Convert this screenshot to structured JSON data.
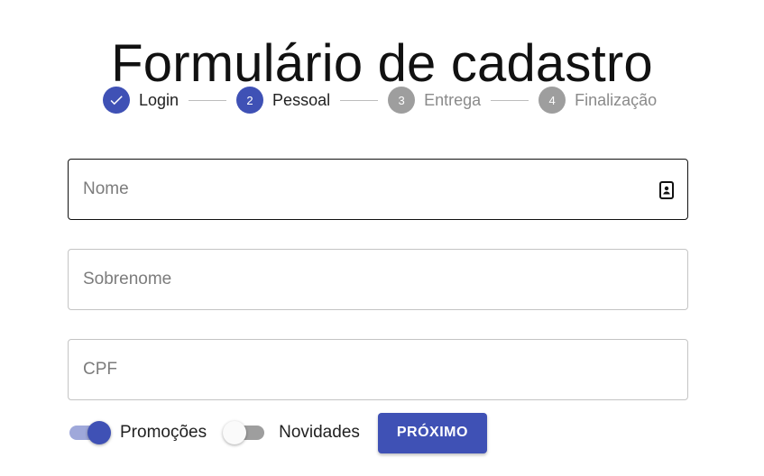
{
  "page_title": "Formulário de cadastro",
  "stepper": {
    "steps": [
      {
        "label": "Login",
        "number": "1",
        "state": "completed"
      },
      {
        "label": "Pessoal",
        "number": "2",
        "state": "active"
      },
      {
        "label": "Entrega",
        "number": "3",
        "state": "inactive"
      },
      {
        "label": "Finalização",
        "number": "4",
        "state": "inactive"
      }
    ]
  },
  "form": {
    "nome": {
      "placeholder": "Nome",
      "value": "",
      "icon": "contact-card-icon"
    },
    "sobrenome": {
      "placeholder": "Sobrenome",
      "value": ""
    },
    "cpf": {
      "placeholder": "CPF",
      "value": ""
    }
  },
  "toggles": {
    "promocoes": {
      "label": "Promoções",
      "on": true
    },
    "novidades": {
      "label": "Novidades",
      "on": false
    }
  },
  "next_button_label": "PRÓXIMO",
  "colors": {
    "primary": "#3f51b5",
    "primary_light": "#9fa8da",
    "inactive": "#9e9e9e"
  }
}
